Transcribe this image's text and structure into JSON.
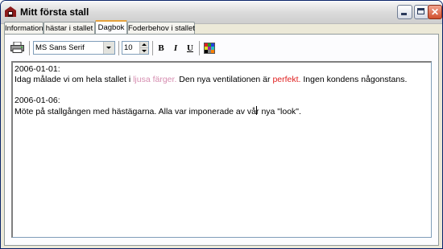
{
  "window": {
    "title": "Mitt första stall"
  },
  "tabs": [
    {
      "label": "Information"
    },
    {
      "label": "hästar i stallet"
    },
    {
      "label": "Dagbok",
      "active": true
    },
    {
      "label": "Foderbehov i stallet"
    }
  ],
  "toolbar": {
    "font_name": "MS Sans Serif",
    "font_size": "10",
    "bold_label": "B",
    "italic_label": "I",
    "underline_label": "U"
  },
  "colors": {
    "pink_text": "#d68db0",
    "red_text": "#e02020",
    "active_tab_accent": "#e6a23c"
  },
  "diary": {
    "entry1_date": "2006-01-01:",
    "entry1_part1": "Idag målade vi om hela stallet i ",
    "entry1_pink": "ljusa färger.",
    "entry1_part2": " Den nya ventilationen är ",
    "entry1_red": "perfekt.",
    "entry1_part3": " Ingen kondens någonstans.",
    "entry2_date": "2006-01-06:",
    "entry2_part1": "Möte på stallgången med hästägarna. Alla var imponerade av vå",
    "entry2_part2": "r nya \"look\"."
  }
}
